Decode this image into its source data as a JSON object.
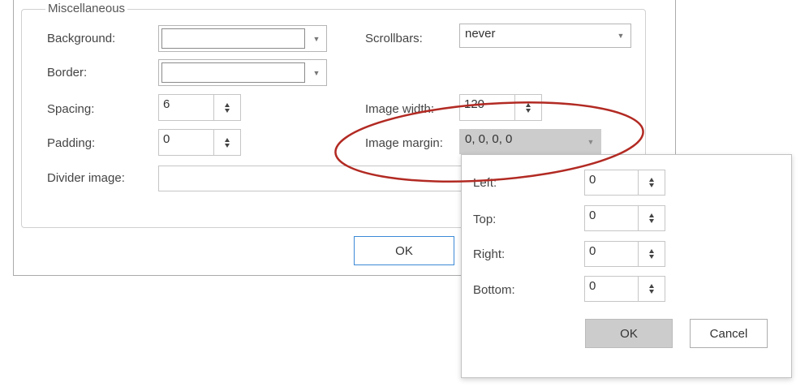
{
  "dialog": {
    "group_title": "Miscellaneous",
    "background": {
      "label": "Background:"
    },
    "border": {
      "label": "Border:"
    },
    "spacing": {
      "label": "Spacing:",
      "value": "6"
    },
    "padding": {
      "label": "Padding:",
      "value": "0"
    },
    "divider_image": {
      "label": "Divider image:",
      "value": ""
    },
    "scrollbars": {
      "label": "Scrollbars:",
      "value": "never"
    },
    "image_width": {
      "label": "Image width:",
      "value": "120"
    },
    "image_margin": {
      "label": "Image margin:",
      "value": "0, 0, 0, 0"
    },
    "ok_label": "OK"
  },
  "margin_popup": {
    "left": {
      "label": "Left:",
      "value": "0"
    },
    "top": {
      "label": "Top:",
      "value": "0"
    },
    "right": {
      "label": "Right:",
      "value": "0"
    },
    "bottom": {
      "label": "Bottom:",
      "value": "0"
    },
    "ok_label": "OK",
    "cancel_label": "Cancel"
  },
  "colors": {
    "highlight_ellipse": "#b22a23",
    "ok_button_border": "#3c8ad6",
    "popup_ok_background": "#cccccc"
  },
  "icons": {
    "dropdown": "chevron-down-icon",
    "spinner": "spinner-arrows-icon"
  }
}
